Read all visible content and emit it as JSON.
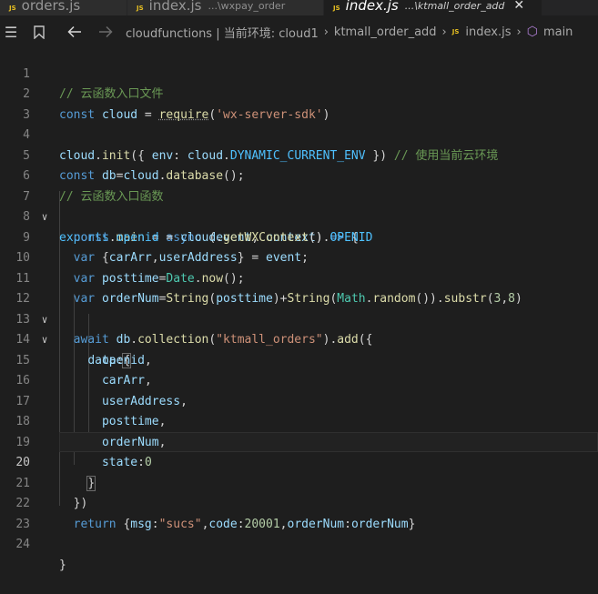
{
  "tabs": [
    {
      "badge": "JS",
      "name": "orders.js",
      "path": ""
    },
    {
      "badge": "JS",
      "name": "index.js",
      "path": "...\\wxpay_order"
    },
    {
      "badge": "JS",
      "name": "index.js",
      "path": "...\\ktmall_order_add",
      "close": "✕"
    }
  ],
  "breadcrumb": {
    "root": "cloudfunctions | 当前环境: cloud1",
    "folder": "ktmall_order_add",
    "file_badge": "JS",
    "file": "index.js",
    "symbol": "main"
  },
  "editor": {
    "current_line": 20,
    "line_numbers": [
      "1",
      "2",
      "3",
      "4",
      "5",
      "6",
      "7",
      "8",
      "9",
      "10",
      "11",
      "12",
      "13",
      "14",
      "15",
      "16",
      "17",
      "18",
      "19",
      "20",
      "21",
      "22",
      "23",
      "24"
    ],
    "comments": {
      "l1": "// 云函数入口文件",
      "l4": "// 使用当前云环境",
      "l6": "// 云函数入口函数"
    },
    "strings": {
      "sdk": "'wx-server-sdk'",
      "collection": "\"ktmall_orders\"",
      "msg": "\"sucs\""
    },
    "numbers": {
      "substr_start": "3",
      "substr_end": "8",
      "state": "0",
      "code": "20001"
    }
  }
}
